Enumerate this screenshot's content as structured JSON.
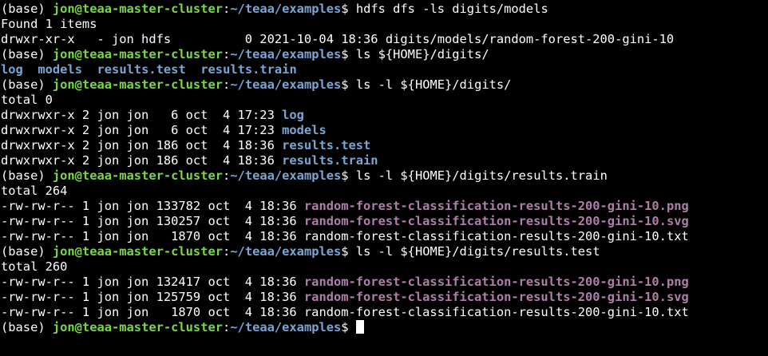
{
  "terminal": {
    "colors": {
      "background": "#000000",
      "text": "#ffffff",
      "prompt_user": "#7bd74a",
      "prompt_path": "#7aa6d6",
      "directory": "#7aa6d6",
      "image_file": "#b07eab"
    },
    "lines": [
      {
        "type": "prompt",
        "env": "(base) ",
        "user": "jon@teaa-master-cluster",
        "sep": ":",
        "path": "~/teaa/examples",
        "cmd": "$ hdfs dfs -ls digits/models"
      },
      {
        "type": "text",
        "text": "Found 1 items"
      },
      {
        "type": "text",
        "text": "drwxr-xr-x   - jon hdfs          0 2021-10-04 18:36 digits/models/random-forest-200-gini-10"
      },
      {
        "type": "prompt",
        "env": "(base) ",
        "user": "jon@teaa-master-cluster",
        "sep": ":",
        "path": "~/teaa/examples",
        "cmd": "$ ls ${HOME}/digits/"
      },
      {
        "type": "lslist",
        "items": [
          "log",
          "models",
          "results.test",
          "results.train"
        ]
      },
      {
        "type": "prompt",
        "env": "(base) ",
        "user": "jon@teaa-master-cluster",
        "sep": ":",
        "path": "~/teaa/examples",
        "cmd": "$ ls -l ${HOME}/digits/"
      },
      {
        "type": "text",
        "text": "total 0"
      },
      {
        "type": "entry",
        "meta": "drwxrwxr-x 2 jon jon   6 oct  4 17:23 ",
        "name": "log",
        "kind": "dir"
      },
      {
        "type": "entry",
        "meta": "drwxrwxr-x 2 jon jon   6 oct  4 17:23 ",
        "name": "models",
        "kind": "dir"
      },
      {
        "type": "entry",
        "meta": "drwxrwxr-x 2 jon jon 186 oct  4 18:36 ",
        "name": "results.test",
        "kind": "dir"
      },
      {
        "type": "entry",
        "meta": "drwxrwxr-x 2 jon jon 186 oct  4 18:36 ",
        "name": "results.train",
        "kind": "dir"
      },
      {
        "type": "prompt",
        "env": "(base) ",
        "user": "jon@teaa-master-cluster",
        "sep": ":",
        "path": "~/teaa/examples",
        "cmd": "$ ls -l ${HOME}/digits/results.train"
      },
      {
        "type": "text",
        "text": "total 264"
      },
      {
        "type": "entry",
        "meta": "-rw-rw-r-- 1 jon jon 133782 oct  4 18:36 ",
        "name": "random-forest-classification-results-200-gini-10.png",
        "kind": "img"
      },
      {
        "type": "entry",
        "meta": "-rw-rw-r-- 1 jon jon 130257 oct  4 18:36 ",
        "name": "random-forest-classification-results-200-gini-10.svg",
        "kind": "img"
      },
      {
        "type": "entry",
        "meta": "-rw-rw-r-- 1 jon jon   1870 oct  4 18:36 ",
        "name": "random-forest-classification-results-200-gini-10.txt",
        "kind": "file"
      },
      {
        "type": "prompt",
        "env": "(base) ",
        "user": "jon@teaa-master-cluster",
        "sep": ":",
        "path": "~/teaa/examples",
        "cmd": "$ ls -l ${HOME}/digits/results.test"
      },
      {
        "type": "text",
        "text": "total 260"
      },
      {
        "type": "entry",
        "meta": "-rw-rw-r-- 1 jon jon 132417 oct  4 18:36 ",
        "name": "random-forest-classification-results-200-gini-10.png",
        "kind": "img"
      },
      {
        "type": "entry",
        "meta": "-rw-rw-r-- 1 jon jon 125759 oct  4 18:36 ",
        "name": "random-forest-classification-results-200-gini-10.svg",
        "kind": "img"
      },
      {
        "type": "entry",
        "meta": "-rw-rw-r-- 1 jon jon   1870 oct  4 18:36 ",
        "name": "random-forest-classification-results-200-gini-10.txt",
        "kind": "file"
      },
      {
        "type": "prompt",
        "env": "(base) ",
        "user": "jon@teaa-master-cluster",
        "sep": ":",
        "path": "~/teaa/examples",
        "cmd": "$ ",
        "cursor": true
      }
    ]
  }
}
